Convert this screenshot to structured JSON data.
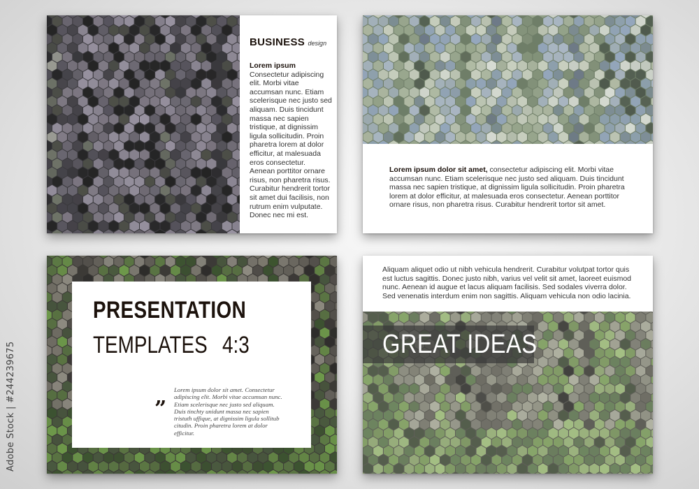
{
  "slide1": {
    "title_main": "BUSINESS",
    "title_sub": "design",
    "heading": "Lorem ipsum",
    "body": "Consectetur adipiscing elit. Morbi vitae accumsan nunc. Etiam scelerisque nec justo sed aliquam. Duis tincidunt massa nec sapien tristique, at dignissim ligula sollicitudin. Proin pharetra lorem at dolor efficitur, at malesuada eros consectetur. Aenean porttitor ornare risus, non pharetra risus. Curabitur hendrerit tortor sit amet dui facilisis, non rutrum enim vulputate. Donec nec mi est."
  },
  "slide2": {
    "lead": "Lorem ipsum dolor sit amet,",
    "body": " consectetur adipiscing elit. Morbi vitae accumsan nunc. Etiam scelerisque nec justo sed aliquam. Duis tincidunt massa nec sapien tristique, at dignissim ligula sollicitudin. Proin pharetra lorem at dolor efficitur, at malesuada eros consectetur. Aenean porttitor ornare risus, non pharetra risus. Curabitur hendrerit tortor sit amet."
  },
  "slide3": {
    "title_line1": "PRESENTATION",
    "title_line2": "TEMPLATES",
    "ratio": "4:3",
    "quote_mark": "”",
    "quote_text": "Lorem ipsum dolor sit amet. Consectetur adipiscing elit. Morbi vitae accumsan nunc. Etiam scelerisque nec justo sed aliquam. Duis tinchty unidunt massa nec sapien tristuth uffique, at dignissim ligula sollitub citudin. Proin pharetra lorem at dolor efficitur."
  },
  "slide4": {
    "body": "Aliquam aliquet odio ut nibh vehicula hendrerit. Curabitur volutpat tortor quis est luctus sagittis. Donec justo nibh, varius vel velit sit amet, laoreet euismod nunc. Aenean id augue et lacus aliquam facilisis. Sed sodales viverra dolor. Sed venenatis interdum enim non sagittis. Aliquam vehicula non odio lacinia.",
    "headline": "GREAT IDEAS"
  },
  "watermark": {
    "vertical_text": "Adobe Stock | #244239675"
  },
  "colors": {
    "title_dark": "#1c120c",
    "body_text": "#333333",
    "headline_text": "#ffffff",
    "headline_band": "rgba(55,55,55,0.7)"
  },
  "icons": {
    "quote": "closing-double-quote"
  }
}
